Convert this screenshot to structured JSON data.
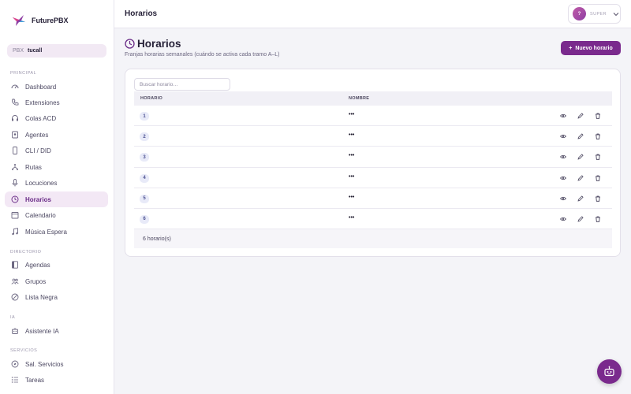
{
  "brand": {
    "name": "FuturePBX",
    "logo_icon": "bird-logo-icon"
  },
  "pbx": {
    "label": "PBX",
    "value": "tucall"
  },
  "sidebar": {
    "sections": [
      {
        "title": "PRINCIPAL"
      },
      {
        "title": "DIRECTORIO"
      },
      {
        "title": "IA"
      },
      {
        "title": "SERVICIOS"
      }
    ],
    "items": [
      {
        "label": "Dashboard",
        "icon": "dashboard-icon"
      },
      {
        "label": "Extensiones",
        "icon": "phone-icon"
      },
      {
        "label": "Colas ACD",
        "icon": "headset-icon"
      },
      {
        "label": "Agentes",
        "icon": "badge-icon"
      },
      {
        "label": "CLI / DID",
        "icon": "mobile-icon"
      },
      {
        "label": "Rutas",
        "icon": "routes-icon"
      },
      {
        "label": "Locuciones",
        "icon": "microphone-icon"
      },
      {
        "label": "Horarios",
        "icon": "clock-icon",
        "active": true
      },
      {
        "label": "Calendario",
        "icon": "calendar-icon"
      },
      {
        "label": "Música Espera",
        "icon": "music-icon"
      },
      {
        "label": "Agendas",
        "icon": "book-icon"
      },
      {
        "label": "Grupos",
        "icon": "users-icon"
      },
      {
        "label": "Lista Negra",
        "icon": "block-icon"
      },
      {
        "label": "Asistente IA",
        "icon": "robot-icon"
      },
      {
        "label": "Sal. Servicios",
        "icon": "compass-icon"
      },
      {
        "label": "Tareas",
        "icon": "list-icon"
      }
    ]
  },
  "topbar": {
    "title": "Horarios"
  },
  "user": {
    "avatar_initial": "?",
    "role": "SUPER"
  },
  "page": {
    "title": "Horarios",
    "subtitle": "Franjas horarias semanales (cuándo se activa cada tramo A–L)",
    "new_button_label": "Nuevo horario"
  },
  "search": {
    "placeholder": "Buscar horario…"
  },
  "table": {
    "columns": [
      "HORARIO",
      "NOMBRE"
    ],
    "rows": [
      {
        "horario": "1",
        "nombre": "•••"
      },
      {
        "horario": "2",
        "nombre": "•••"
      },
      {
        "horario": "3",
        "nombre": "•••"
      },
      {
        "horario": "4",
        "nombre": "•••"
      },
      {
        "horario": "5",
        "nombre": "•••"
      },
      {
        "horario": "6",
        "nombre": "•••"
      }
    ],
    "footer": "6 horario(s)"
  },
  "colors": {
    "accent": "#7a2a8d",
    "active_bg": "#f3e8f5"
  }
}
